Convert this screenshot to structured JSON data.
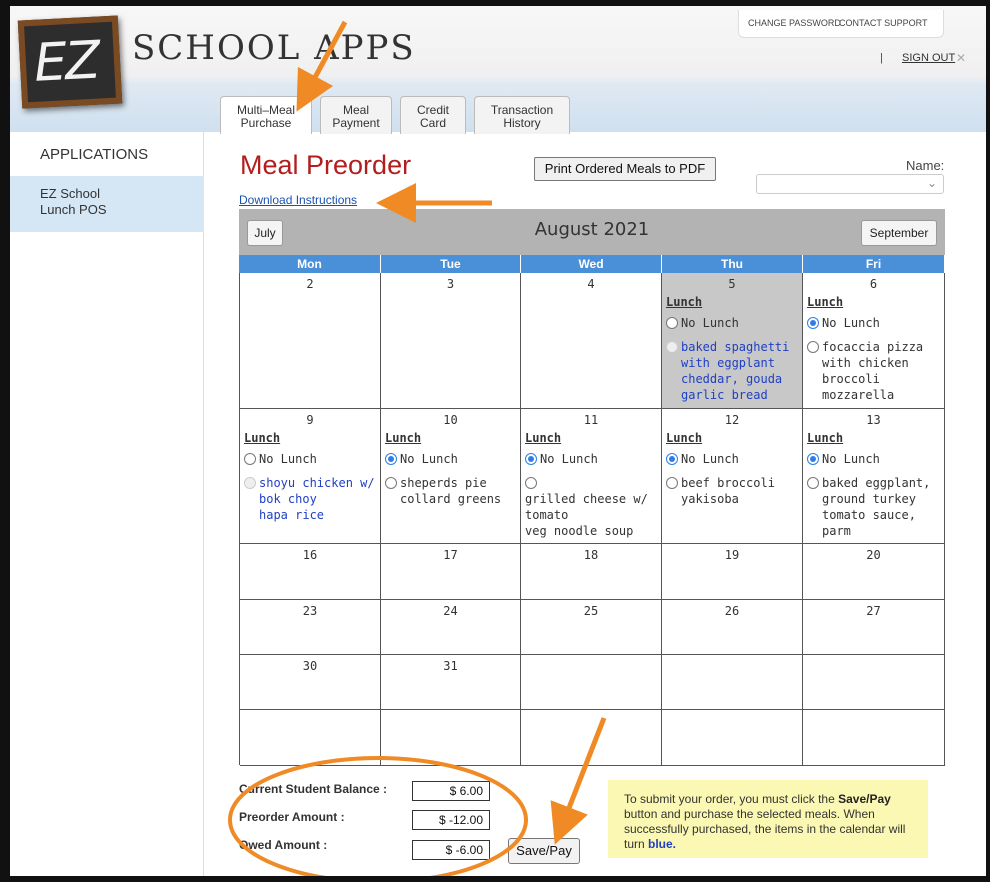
{
  "header": {
    "logo_mark": "EZ",
    "logo_text": "SCHOOL APPS",
    "change_password": "CHANGE PASSWORD",
    "contact_support": "CONTACT SUPPORT",
    "separator": "|",
    "sign_out": "SIGN OUT",
    "sign_out_icon": "x-icon"
  },
  "tabs": [
    {
      "line1": "Multi–Meal",
      "line2": "Purchase"
    },
    {
      "line1": "Meal",
      "line2": "Payment"
    },
    {
      "line1": "Credit",
      "line2": "Card"
    },
    {
      "line1": "Transaction",
      "line2": "History"
    }
  ],
  "sidebar": {
    "title": "APPLICATIONS",
    "items": [
      {
        "line1": "EZ School",
        "line2": "Lunch POS"
      }
    ]
  },
  "main": {
    "title": "Meal Preorder",
    "print_button": "Print Ordered Meals to PDF",
    "name_label": "Name:",
    "name_value": "",
    "download_link": "Download Instructions"
  },
  "calendar": {
    "month_title": "August 2021",
    "prev_month": "July",
    "next_month": "September",
    "weekdays": [
      "Mon",
      "Tue",
      "Wed",
      "Thu",
      "Fri"
    ],
    "lunch_label": "Lunch",
    "rows": [
      [
        "2",
        "3",
        "4",
        "5",
        "6"
      ],
      [
        "9",
        "10",
        "11",
        "12",
        "13"
      ],
      [
        "16",
        "17",
        "18",
        "19",
        "20"
      ],
      [
        "23",
        "24",
        "25",
        "26",
        "27"
      ],
      [
        "30",
        "31",
        "",
        "",
        ""
      ],
      [
        "",
        "",
        "",
        "",
        ""
      ]
    ],
    "menus": {
      "d5": {
        "no_lunch": "No Lunch",
        "meal": [
          "baked spaghetti",
          "with eggplant",
          "cheddar, gouda",
          "garlic bread"
        ]
      },
      "d6": {
        "no_lunch": "No Lunch",
        "meal": [
          "focaccia pizza",
          "with chicken",
          "broccoli",
          "mozzarella"
        ]
      },
      "d9": {
        "no_lunch": "No Lunch",
        "meal": [
          "shoyu chicken w/",
          "bok choy",
          "hapa rice"
        ]
      },
      "d10": {
        "no_lunch": "No Lunch",
        "meal": [
          "sheperds pie",
          "collard greens"
        ]
      },
      "d11": {
        "no_lunch": "No Lunch",
        "meal": [
          "grilled cheese w/",
          "tomato",
          "veg noodle soup"
        ]
      },
      "d12": {
        "no_lunch": "No Lunch",
        "meal": [
          "beef broccoli",
          "yakisoba"
        ]
      },
      "d13": {
        "no_lunch": "No Lunch",
        "meal": [
          "baked eggplant,",
          "ground turkey",
          "tomato sauce,",
          "parm"
        ]
      }
    }
  },
  "balance": {
    "current_label": "Current Student Balance :",
    "current_value": "$ 6.00",
    "preorder_label": "Preorder Amount :",
    "preorder_value": "$ -12.00",
    "owed_label": "Owed Amount :",
    "owed_value": "$ -6.00",
    "save_button": "Save/Pay"
  },
  "note": {
    "part1": "To submit your order, you must click the",
    "bold": "Save/Pay",
    "part2": " button and purchase the selected meals. When successfully purchased, the items in the calendar will turn ",
    "blue_word": "blue."
  },
  "colors": {
    "title_red": "#b21e1e",
    "day_header_blue": "#4a90d9",
    "purchased_blue": "#1f3fc4",
    "annotation_orange": "#f08a24",
    "note_yellow": "#fbf8b3"
  }
}
